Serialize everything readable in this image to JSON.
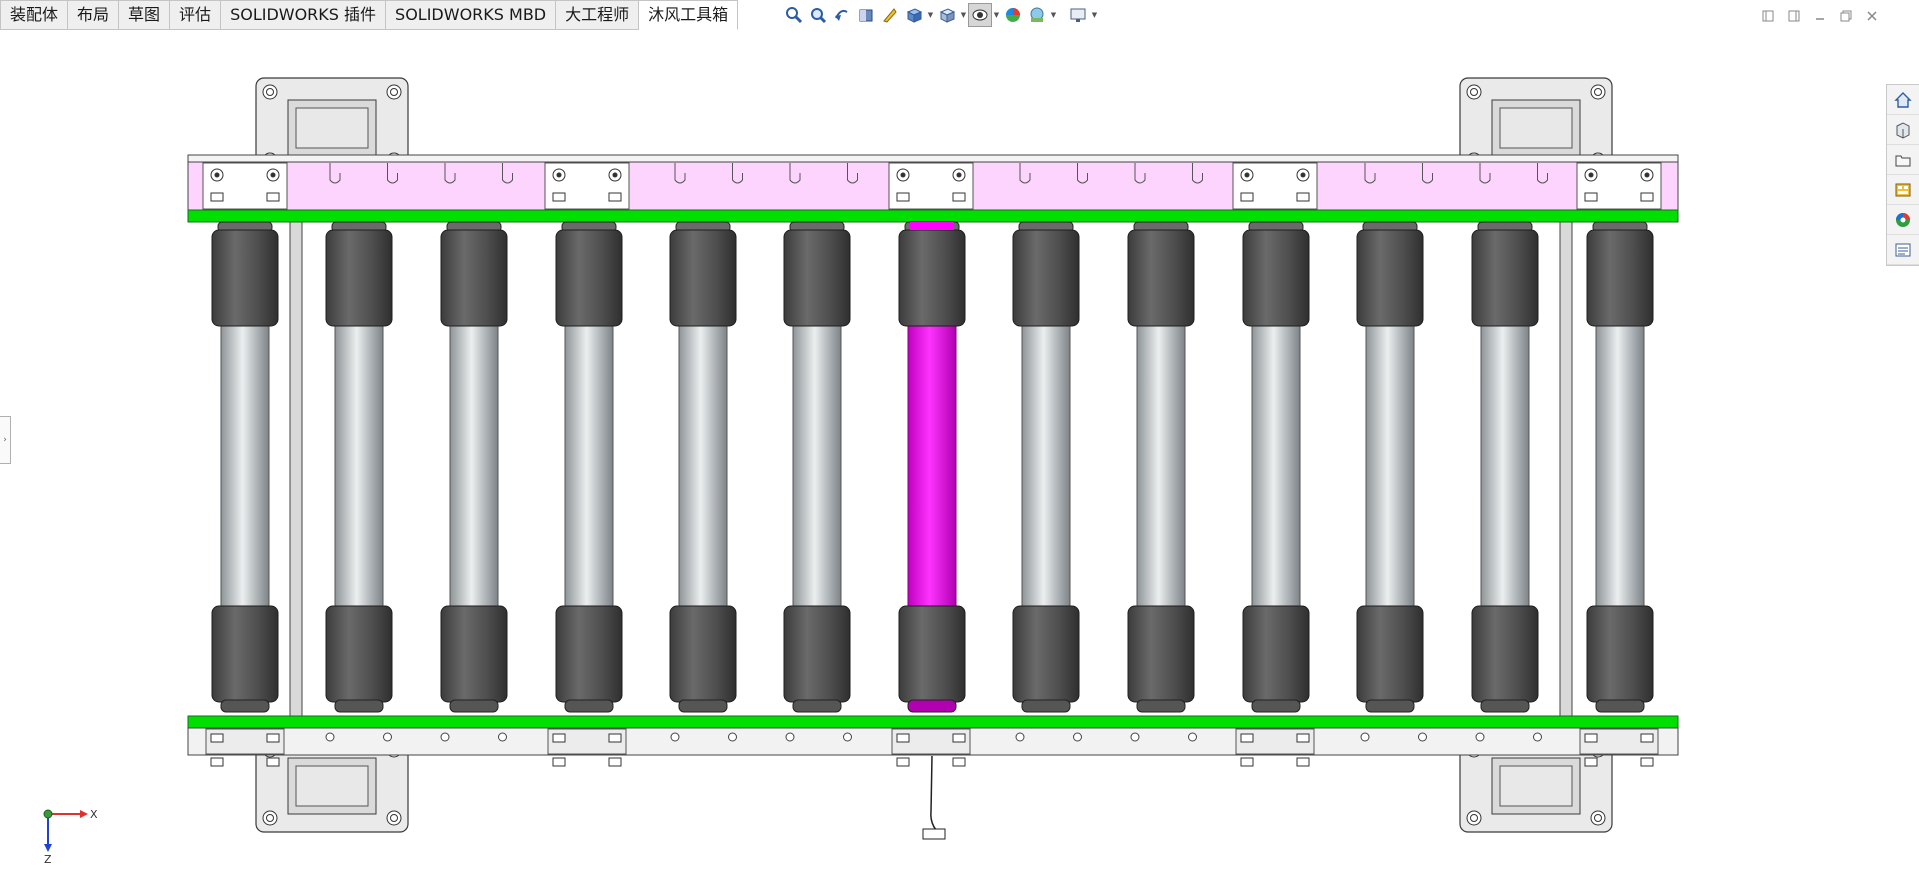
{
  "tabs": [
    "装配体",
    "布局",
    "草图",
    "评估",
    "SOLIDWORKS 插件",
    "SOLIDWORKS MBD",
    "大工程师",
    "沐风工具箱"
  ],
  "active_tab": 7,
  "view_toolbar": [
    "zoom-to-fit-icon",
    "zoom-to-area-icon",
    "previous-view-icon",
    "section-view-icon",
    "dynamic-annotation-icon",
    "view-orientation-icon",
    "display-style-icon",
    "hide-show-items-icon",
    "edit-appearance-icon",
    "apply-scene-icon",
    "view-settings-icon"
  ],
  "task_pane": [
    "home-icon",
    "design-library-icon",
    "file-explorer-icon",
    "view-palette-icon",
    "appearances-icon",
    "custom-properties-icon"
  ],
  "triad": {
    "x_label": "X",
    "z_label": "Z"
  },
  "colors": {
    "selected_roller": "#ff00ff",
    "guide_rail": "#00e000",
    "bracket_fill": "#fdd4fd",
    "sleeve": "#5a5a5a",
    "roller": "#b9bfc2"
  }
}
